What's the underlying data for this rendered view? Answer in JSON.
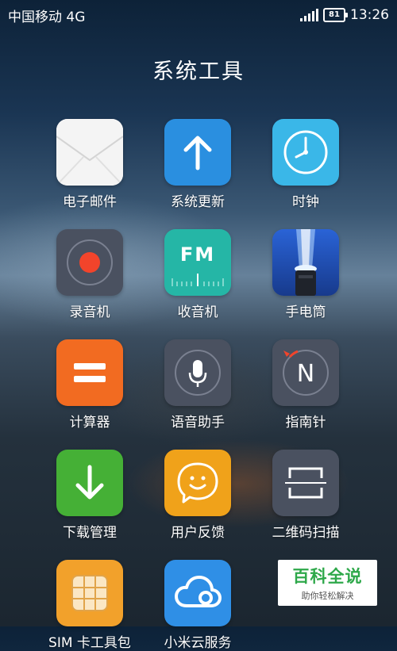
{
  "status_bar": {
    "carrier": "中国移动 4G",
    "battery_level": "81",
    "time": "13:26"
  },
  "folder": {
    "title": "系统工具"
  },
  "apps": [
    {
      "label": "电子邮件",
      "icon": "envelope-icon",
      "color": "#f1f1f1"
    },
    {
      "label": "系统更新",
      "icon": "up-arrow-icon",
      "color": "#2a8fe0"
    },
    {
      "label": "时钟",
      "icon": "clock-icon",
      "color": "#3ab7e8"
    },
    {
      "label": "录音机",
      "icon": "record-icon",
      "color": "#4a5160"
    },
    {
      "label": "收音机",
      "icon": "fm-radio-icon",
      "color": "#25b6a6",
      "icon_text": "FM"
    },
    {
      "label": "手电筒",
      "icon": "flashlight-icon",
      "color": "#1f4aa8"
    },
    {
      "label": "计算器",
      "icon": "equals-icon",
      "color": "#f26b21"
    },
    {
      "label": "语音助手",
      "icon": "microphone-icon",
      "color": "#4a5160"
    },
    {
      "label": "指南针",
      "icon": "compass-icon",
      "color": "#4a5160",
      "icon_text": "N"
    },
    {
      "label": "下载管理",
      "icon": "download-icon",
      "color": "#45b036"
    },
    {
      "label": "用户反馈",
      "icon": "smile-chat-icon",
      "color": "#f0a21a"
    },
    {
      "label": "二维码扫描",
      "icon": "scan-frame-icon",
      "color": "#4a5160"
    },
    {
      "label": "SIM 卡工具包",
      "icon": "sim-card-icon",
      "color": "#f2a12b"
    },
    {
      "label": "小米云服务",
      "icon": "cloud-icon",
      "color": "#2f8fe6"
    }
  ],
  "watermark": {
    "title": "百科全说",
    "subtitle": "助你轻松解决"
  }
}
